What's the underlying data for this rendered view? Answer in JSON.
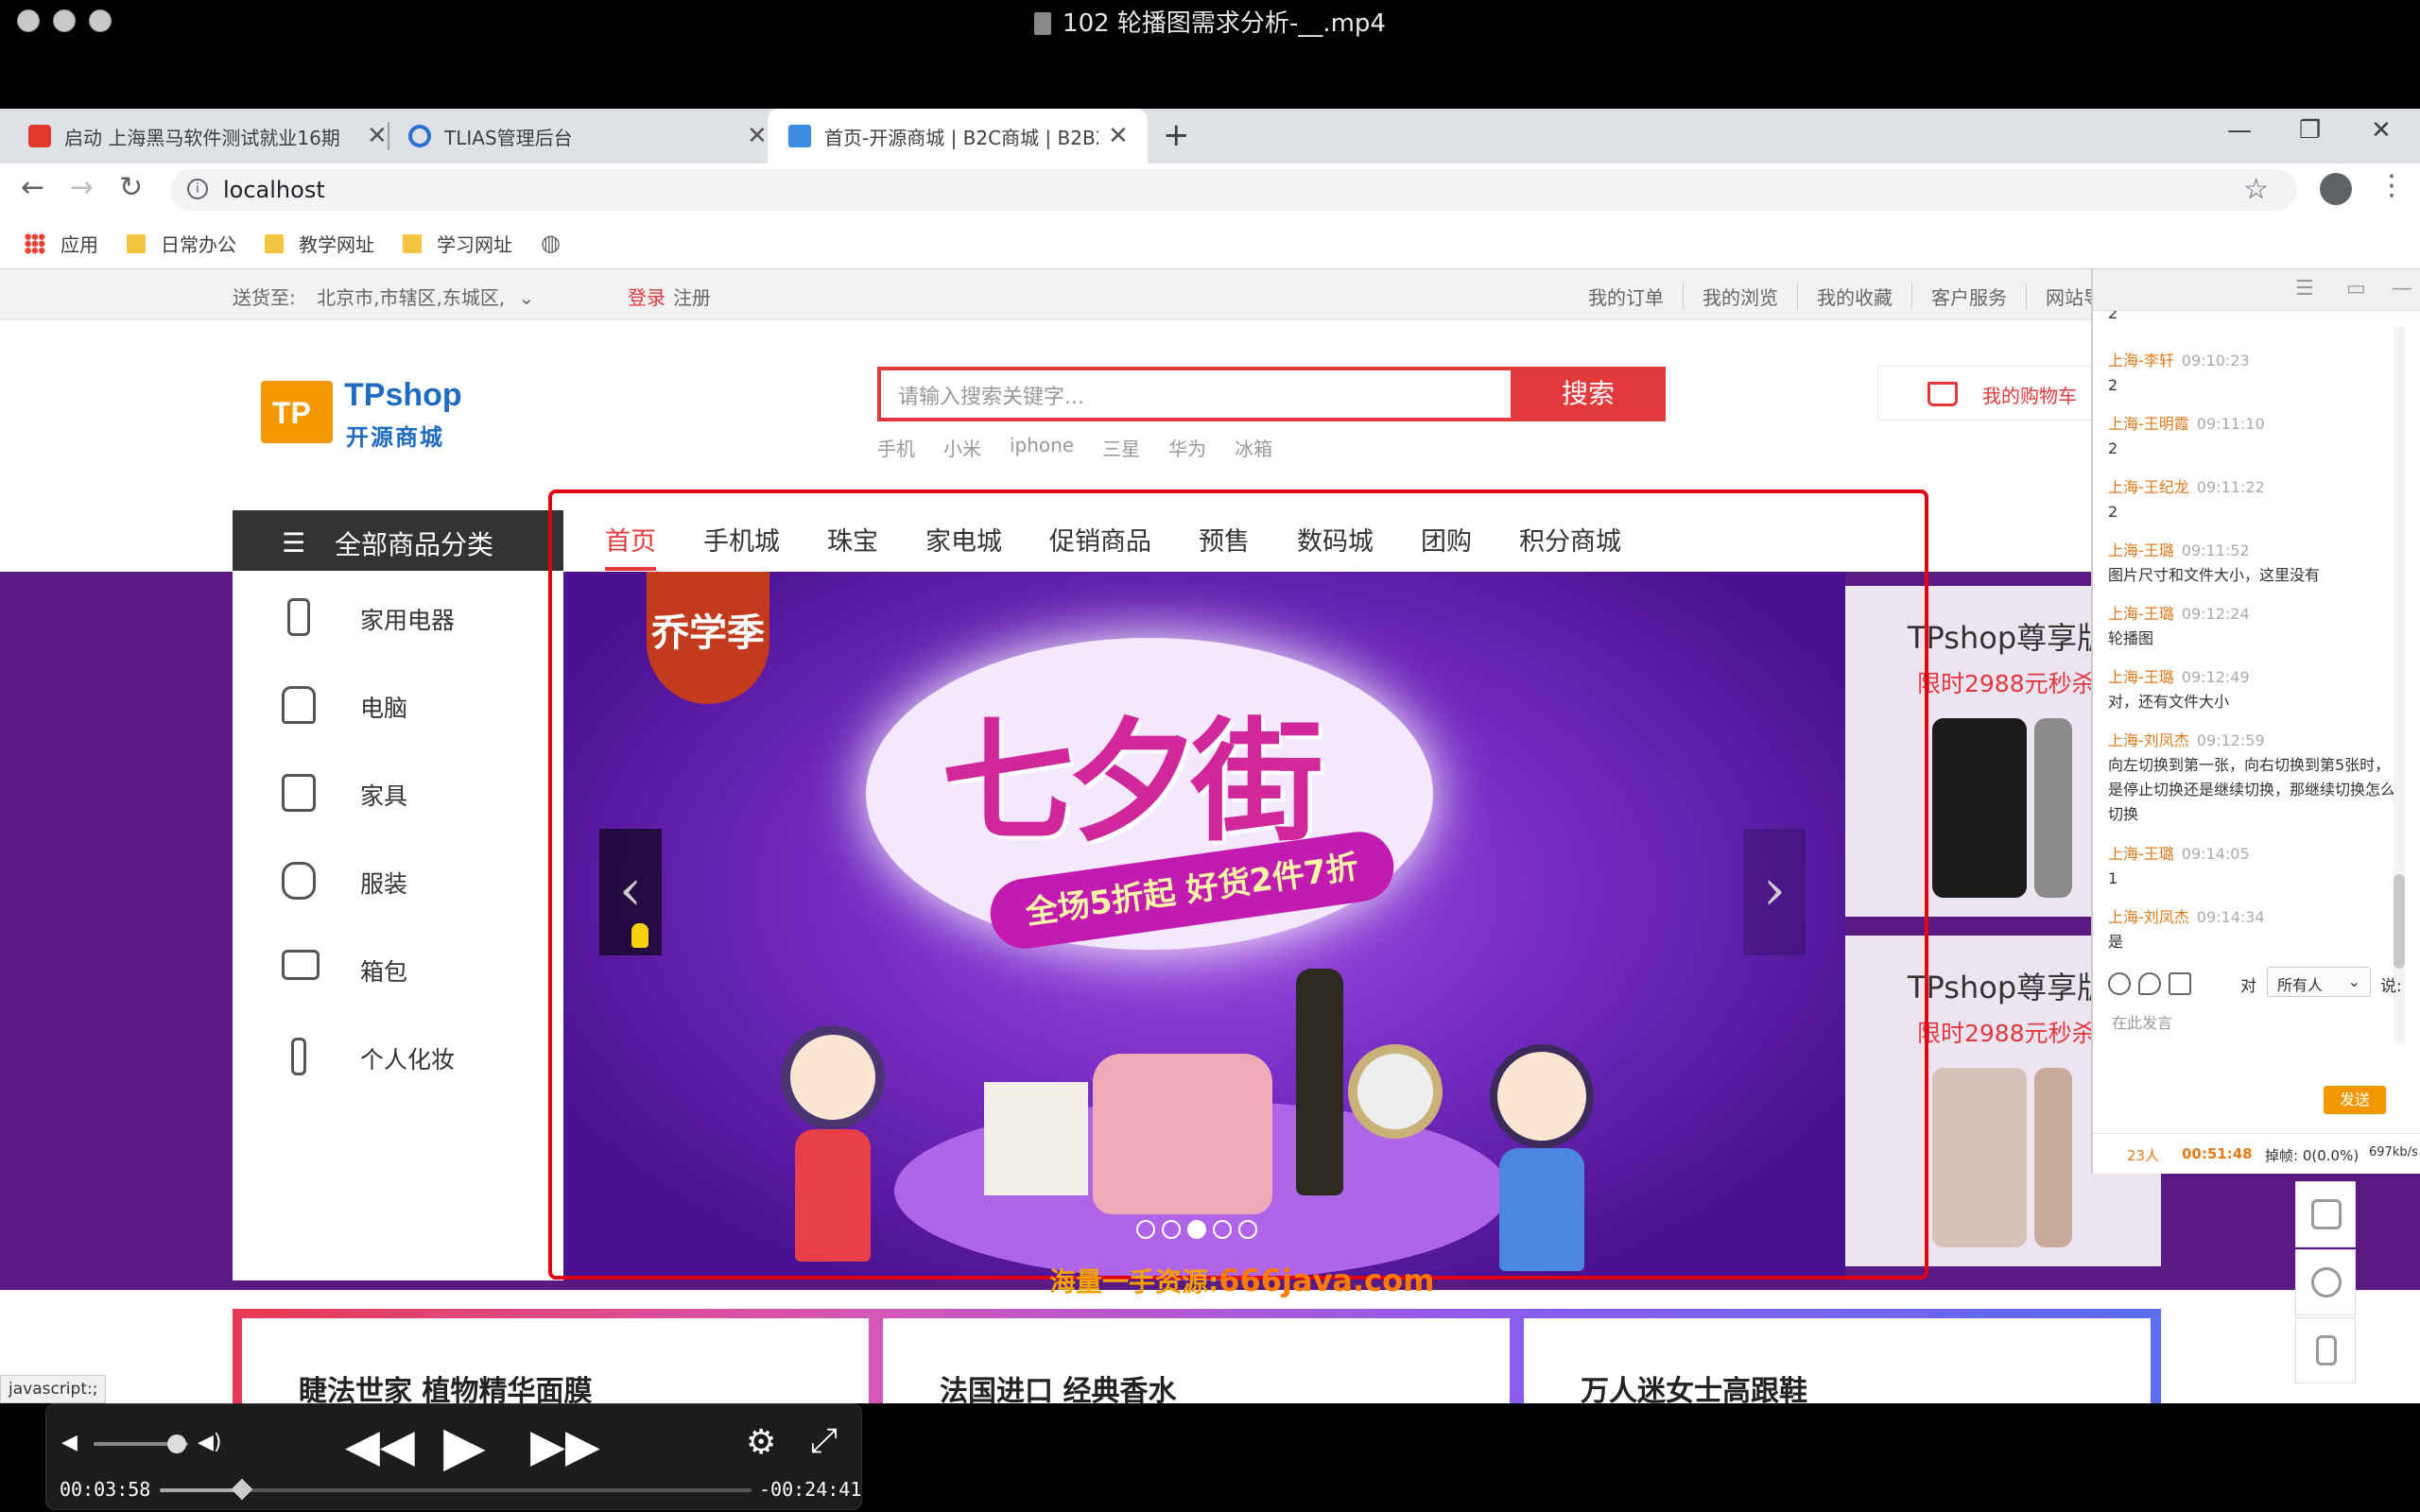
{
  "player_window": {
    "title": "102 轮播图需求分析-__.mp4"
  },
  "browser": {
    "tabs": [
      {
        "label": "启动 上海黑马软件测试就业16期",
        "active": false
      },
      {
        "label": "TLIAS管理后台",
        "active": false
      },
      {
        "label": "首页-开源商城 | B2C商城 | B2B2",
        "active": true
      }
    ],
    "new_tab": "+",
    "window_controls": [
      "—",
      "❐",
      "✕"
    ],
    "url": "localhost",
    "bookmarks": [
      "应用",
      "日常办公",
      "教学网址",
      "学习网址"
    ]
  },
  "site": {
    "shortcut": {
      "deliver_label": "送货至:",
      "deliver_value": "北京市,市辖区,东城区,",
      "login": "登录",
      "register": "注册",
      "links": [
        "我的订单",
        "我的浏览",
        "我的收藏",
        "客户服务",
        "网站导"
      ]
    },
    "logo": {
      "name": "TPshop",
      "sub": "开源商城",
      "badge": "TP"
    },
    "search": {
      "placeholder": "请输入搜索关键字...",
      "button": "搜索",
      "hotwords": [
        "手机",
        "小米",
        "iphone",
        "三星",
        "华为",
        "冰箱"
      ]
    },
    "cart": {
      "label": "我的购物车"
    },
    "category_button": "全部商品分类",
    "nav": [
      "首页",
      "手机城",
      "珠宝",
      "家电城",
      "促销商品",
      "预售",
      "数码城",
      "团购",
      "积分商城"
    ],
    "side_categories": [
      "家用电器",
      "电脑",
      "家具",
      "服装",
      "箱包",
      "个人化妆"
    ],
    "banner": {
      "headline": "七夕街",
      "ribbon": "全场5折起 好货2件7折",
      "seal": "乔学季",
      "prev": "‹",
      "next": "›",
      "slide_count": 5,
      "active_slide": 3
    },
    "promos": [
      {
        "title": "TPshop尊享版",
        "subtitle": "限时2988元秒杀"
      },
      {
        "title": "TPshop尊享版",
        "subtitle": "限时2988元秒杀"
      }
    ],
    "watermark": {
      "text": "海量一手资源:",
      "domain": "666java.com"
    },
    "floors": [
      "睫法世家 植物精华面膜",
      "法国进口 经典香水",
      "万人迷女士高跟鞋"
    ]
  },
  "chat": {
    "messages": [
      {
        "who": "",
        "time": "",
        "body": "2"
      },
      {
        "who": "上海-李轩",
        "time": "09:10:23",
        "body": "2"
      },
      {
        "who": "上海-王明霞",
        "time": "09:11:10",
        "body": "2"
      },
      {
        "who": "上海-王纪龙",
        "time": "09:11:22",
        "body": "2"
      },
      {
        "who": "上海-王璐",
        "time": "09:11:52",
        "body": "图片尺寸和文件大小，这里没有"
      },
      {
        "who": "上海-王璐",
        "time": "09:12:24",
        "body": "轮播图"
      },
      {
        "who": "上海-王璐",
        "time": "09:12:49",
        "body": "对，还有文件大小"
      },
      {
        "who": "上海-刘凤杰",
        "time": "09:12:59",
        "body": "向左切换到第一张，向右切换到第5张时，是停止切换还是继续切换，那继续切换怎么切换"
      },
      {
        "who": "上海-王璐",
        "time": "09:14:05",
        "body": "1"
      },
      {
        "who": "上海-刘凤杰",
        "time": "09:14:34",
        "body": "是"
      }
    ],
    "to_label": "对",
    "to_value": "所有人",
    "say_label": "说:",
    "input_placeholder": "在此发言",
    "send": "发送",
    "status": {
      "people": "23人",
      "elapsed": "00:51:48",
      "drop": "掉帧: 0(0.0%)",
      "rate": "697kb/s"
    }
  },
  "status_text": "javascript:;",
  "playback": {
    "elapsed": "00:03:58",
    "remaining": "-00:24:41",
    "progress": 0.139
  }
}
